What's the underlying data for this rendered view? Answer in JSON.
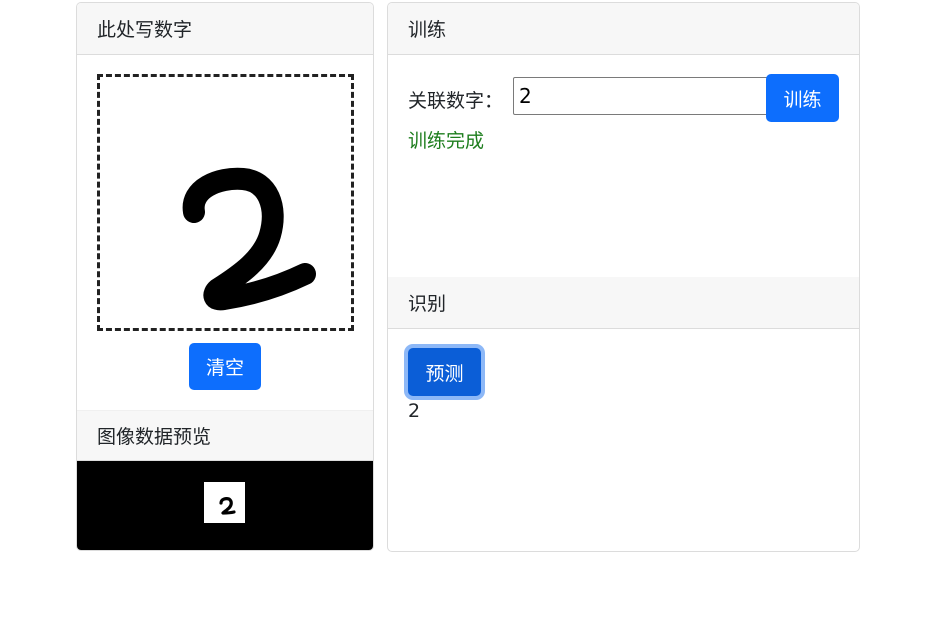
{
  "draw_panel": {
    "header": "此处写数字",
    "clear_label": "清空",
    "preview_header": "图像数据预览",
    "drawn_digit": "2"
  },
  "train_panel": {
    "header": "训练",
    "digit_label": "关联数字：",
    "digit_value": "2",
    "train_label": "训练",
    "status": "训练完成",
    "status_color": "#1e7e1e"
  },
  "recognize_panel": {
    "header": "识别",
    "predict_label": "预测",
    "result": "2"
  },
  "colors": {
    "accent": "#0d6efd",
    "header_bg": "#f7f7f7",
    "border": "#dcdcdc"
  }
}
